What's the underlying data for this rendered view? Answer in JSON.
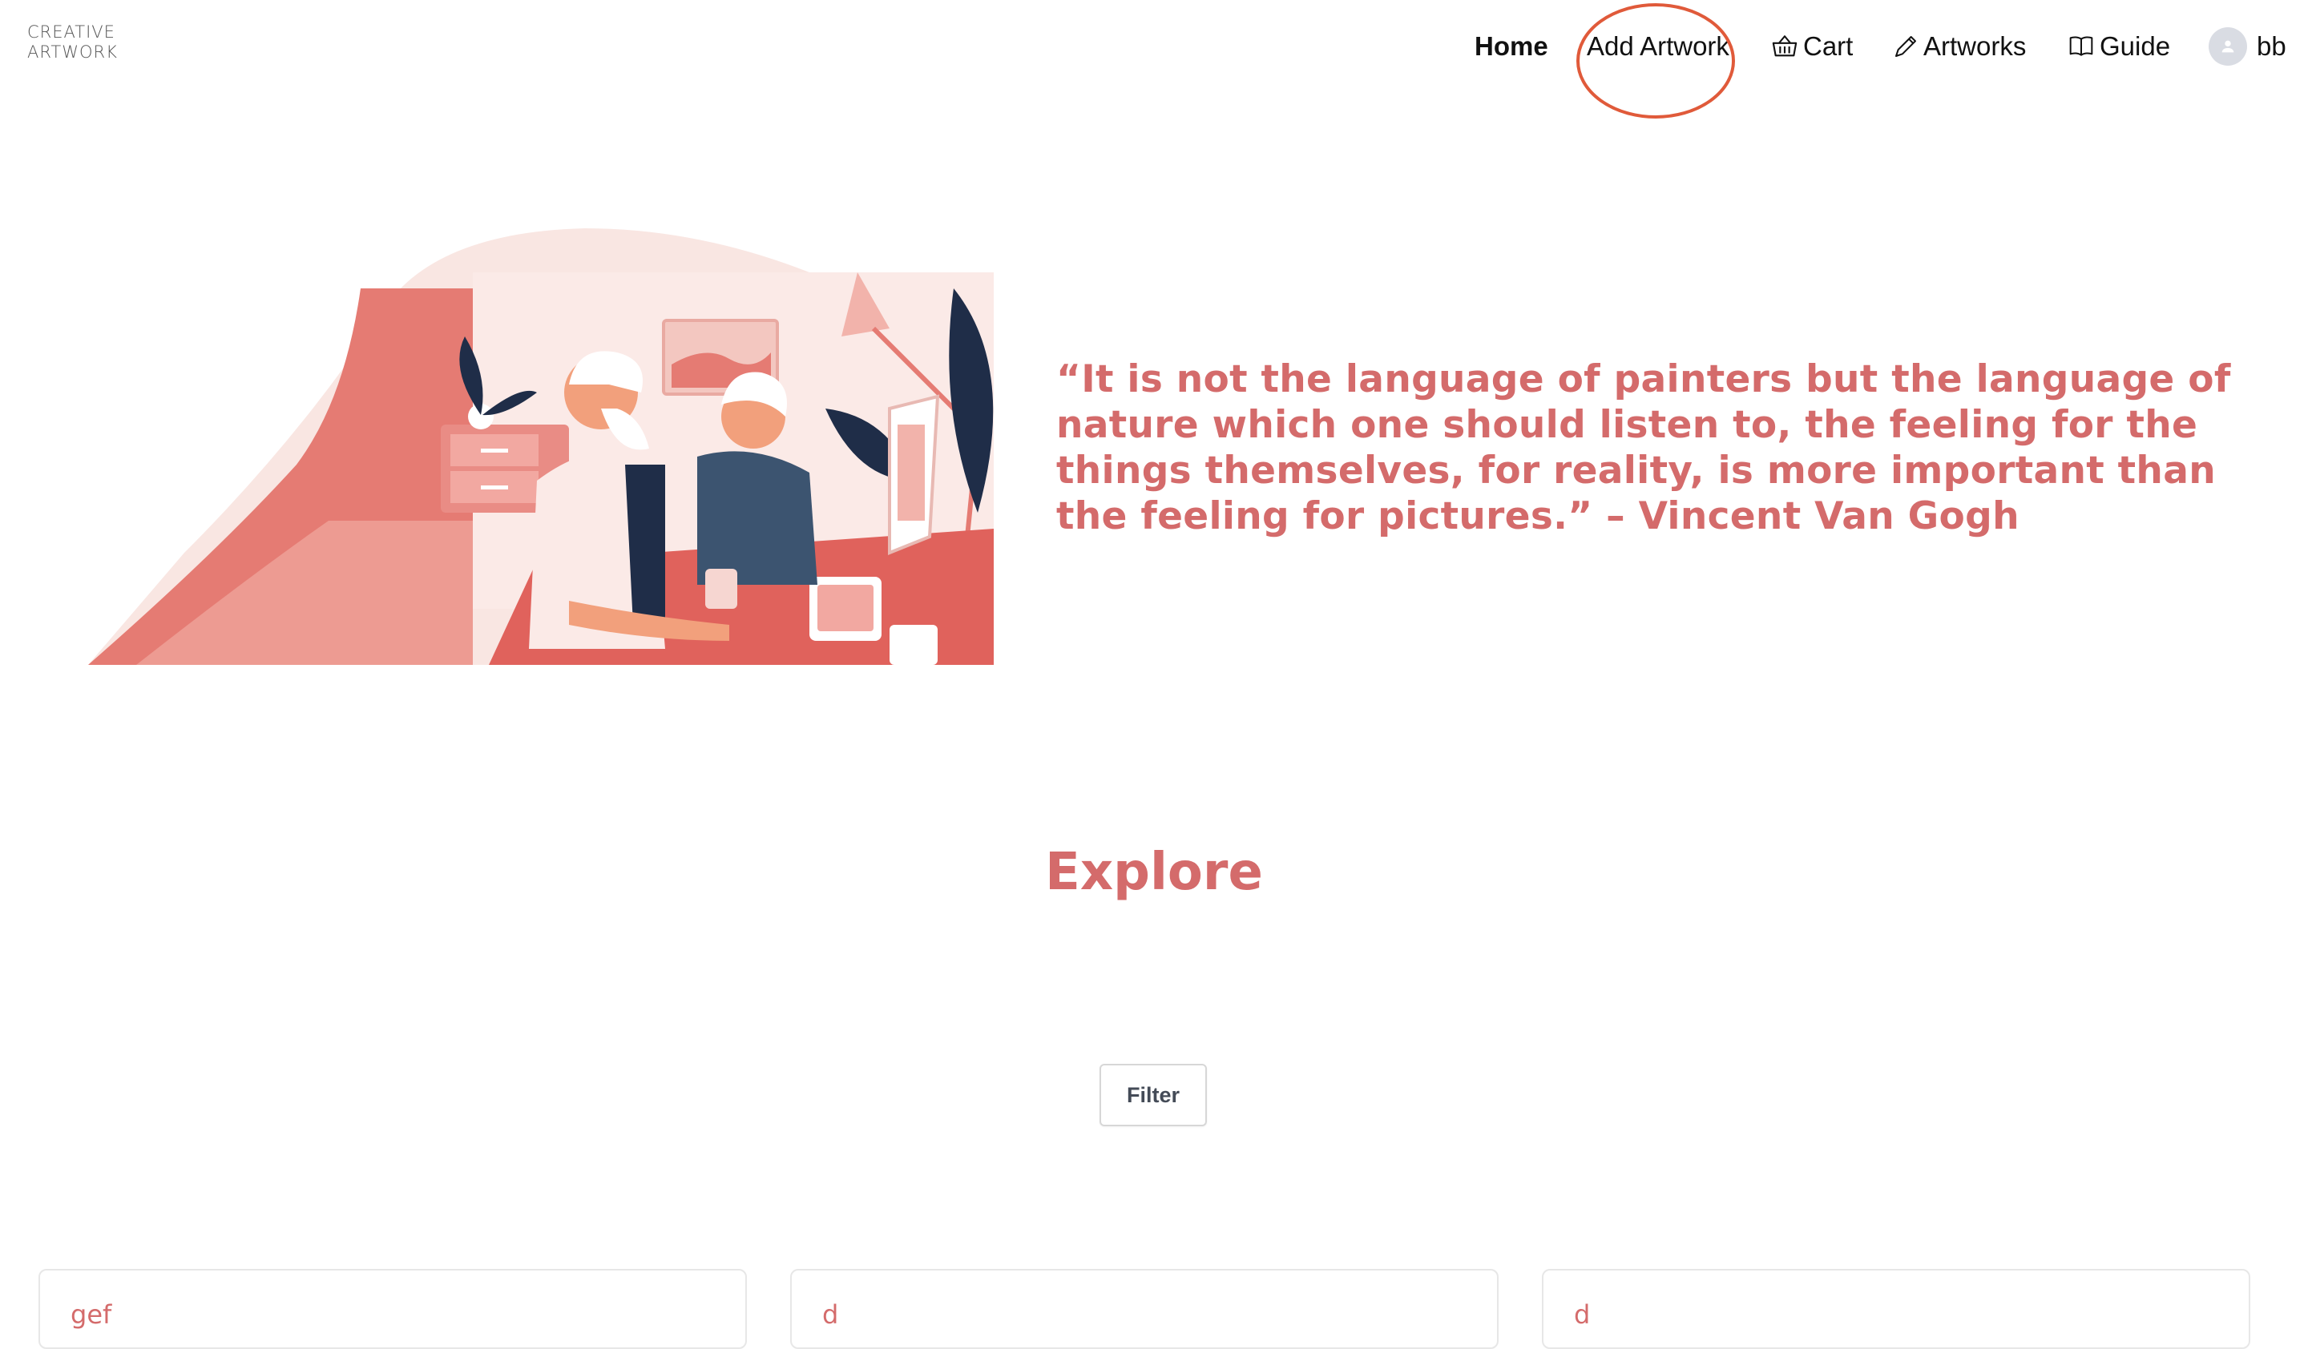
{
  "brand": {
    "line1": "CREATIVE",
    "line2": "ARTWORK"
  },
  "nav": {
    "home": "Home",
    "add_artwork": "Add Artwork",
    "cart": "Cart",
    "artworks": "Artworks",
    "guide": "Guide",
    "user": "bb"
  },
  "hero": {
    "quote": "“It is not the language of painters but the language of nature which one should listen to, the feeling for the things themselves, for reality, is more important than the feeling for pictures.” – Vincent Van Gogh"
  },
  "explore": {
    "title": "Explore",
    "filter_label": "Filter"
  },
  "cards": [
    {
      "title": "gef"
    },
    {
      "title": "d"
    },
    {
      "title": "d"
    }
  ],
  "colors": {
    "accent": "#d46b6b",
    "annotation": "#e05a3a"
  },
  "icons": {
    "cart": "basket-icon",
    "artworks": "pen-icon",
    "guide": "book-icon",
    "user": "user-icon"
  }
}
